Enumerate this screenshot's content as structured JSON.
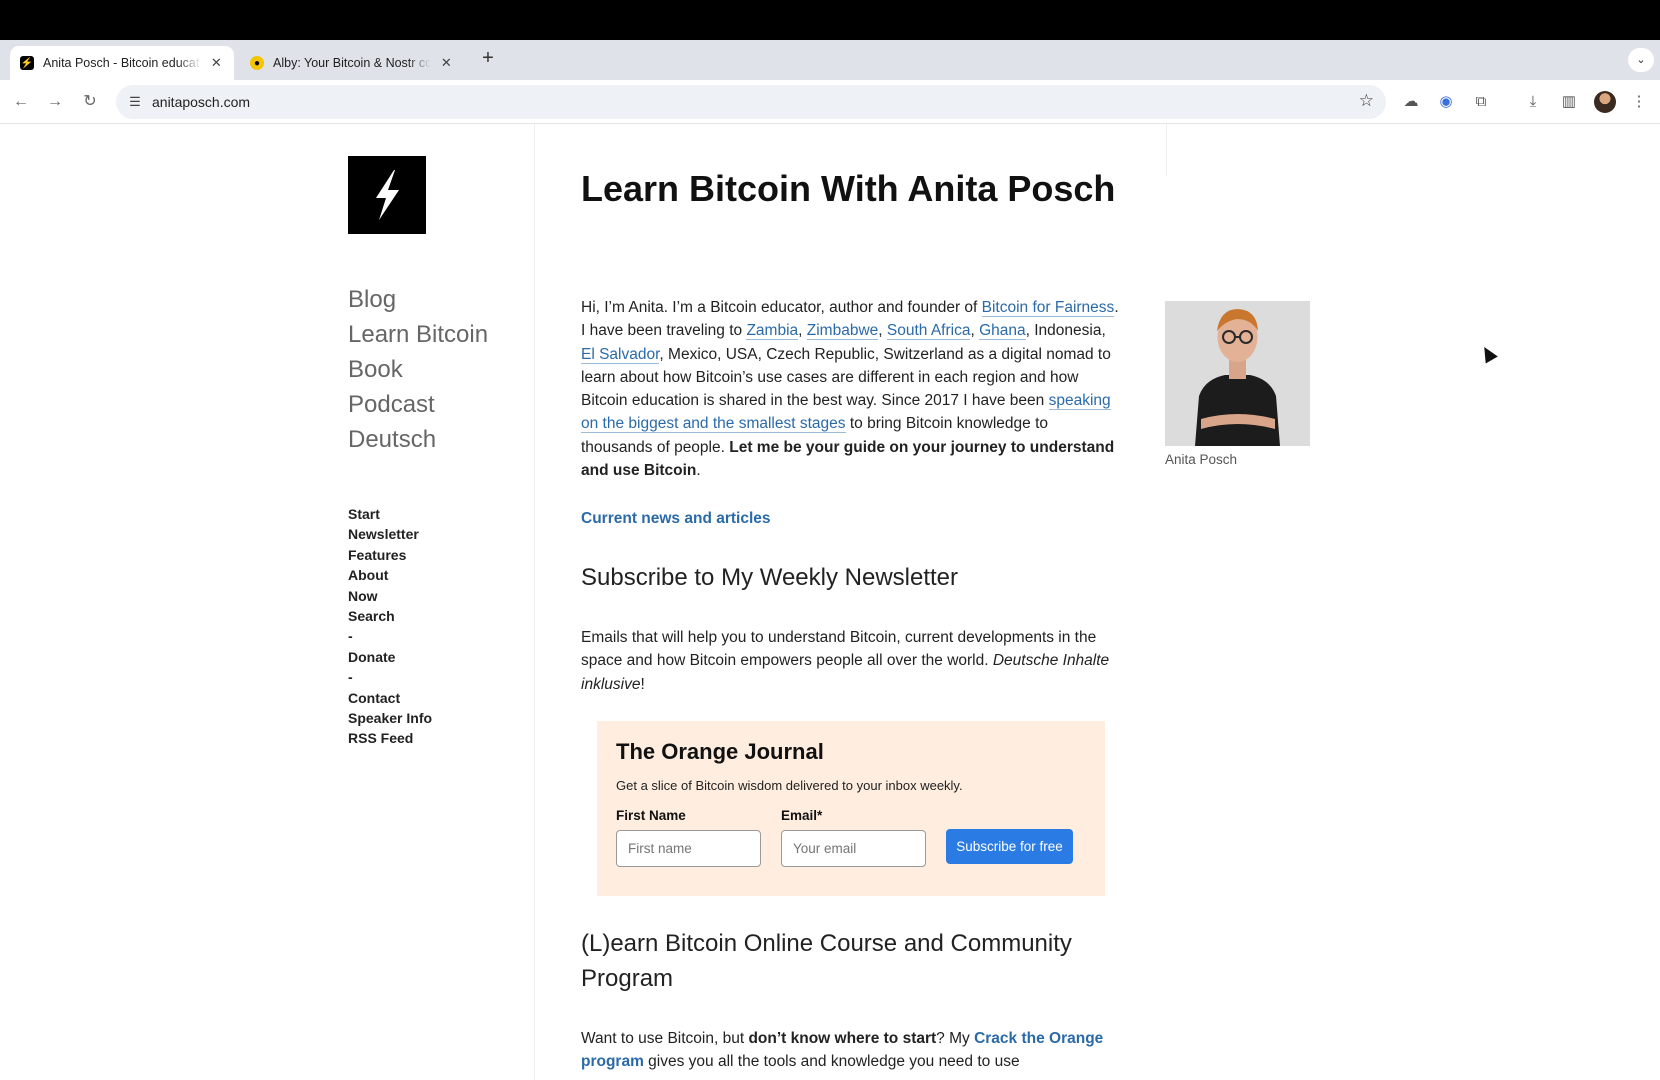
{
  "browser": {
    "tabs": [
      {
        "title": "Anita Posch - Bitcoin educat",
        "close": "✕"
      },
      {
        "title": "Alby: Your Bitcoin & Nostr co",
        "close": "✕"
      }
    ],
    "new_tab": "+",
    "tab_menu": "⌄",
    "url": "anitaposch.com",
    "nav": {
      "back": "←",
      "forward": "→",
      "reload": "↻"
    },
    "icons": [
      "bookmark-star-icon",
      "cloud-icon",
      "alby-extension-icon",
      "extensions-puzzle-icon",
      "download-icon",
      "side-panel-icon",
      "profile-avatar",
      "more-menu-icon"
    ]
  },
  "sidebar": {
    "main_nav": [
      "Blog",
      "Learn Bitcoin",
      "Book",
      "Podcast",
      "Deutsch"
    ],
    "sub_nav": [
      "Start",
      "Newsletter",
      "Features",
      "About",
      "Now",
      "Search",
      "-",
      "Donate",
      "-",
      "Contact",
      "Speaker Info",
      "RSS Feed"
    ]
  },
  "content": {
    "title": "Learn Bitcoin With Anita Posch",
    "intro": {
      "t1": "Hi, I’m Anita. I’m a Bitcoin educator, author and founder of ",
      "l1": "Bitcoin for Fairness",
      "t2": ". I have been traveling to ",
      "l2": "Zambia",
      "t3": ", ",
      "l3": "Zimbabwe",
      "t4": ", ",
      "l4": "South Africa",
      "t5": ", ",
      "l5": "Ghana",
      "t6": ", Indonesia, ",
      "l6": "El Salvador",
      "t7": ", Mexico, USA, Czech Republic, Switzerland as a digital nomad to learn about how Bitcoin’s use cases are different in each region and how Bitcoin education is shared in the best way. Since 2017 I have been ",
      "l7": "speaking on the biggest and the smallest stages",
      "t8": " to bring Bitcoin knowledge to thousands of people. ",
      "strong": "Let me be your guide on your journey to understand and use Bitcoin",
      "t9": "."
    },
    "news_link": "Current news and articles",
    "newsletter_heading": "Subscribe to My Weekly Newsletter",
    "newsletter_text": "Emails that will help you to understand Bitcoin, current developments in the space and how Bitcoin empowers people all over the world. ",
    "newsletter_em": "Deutsche Inhalte inklusive",
    "newsletter_end": "!",
    "course_heading": "(L)earn Bitcoin Online Course and Community Program",
    "course": {
      "t1": "Want to use Bitcoin, but ",
      "strong": "don’t know where to start",
      "t2": "? My ",
      "link": "Crack the Orange program",
      "t3": " gives you all the tools and knowledge you need to use"
    }
  },
  "photo": {
    "caption": "Anita Posch"
  },
  "newsletter_form": {
    "title": "The Orange Journal",
    "description": "Get a slice of Bitcoin wisdom delivered to your inbox weekly.",
    "first_name_label": "First Name",
    "first_name_placeholder": "First name",
    "email_label": "Email*",
    "email_placeholder": "Your email",
    "button": "Subscribe for free"
  },
  "colors": {
    "link": "#2b6aa8",
    "button": "#2b7be4",
    "form_bg": "#ffeee0"
  }
}
